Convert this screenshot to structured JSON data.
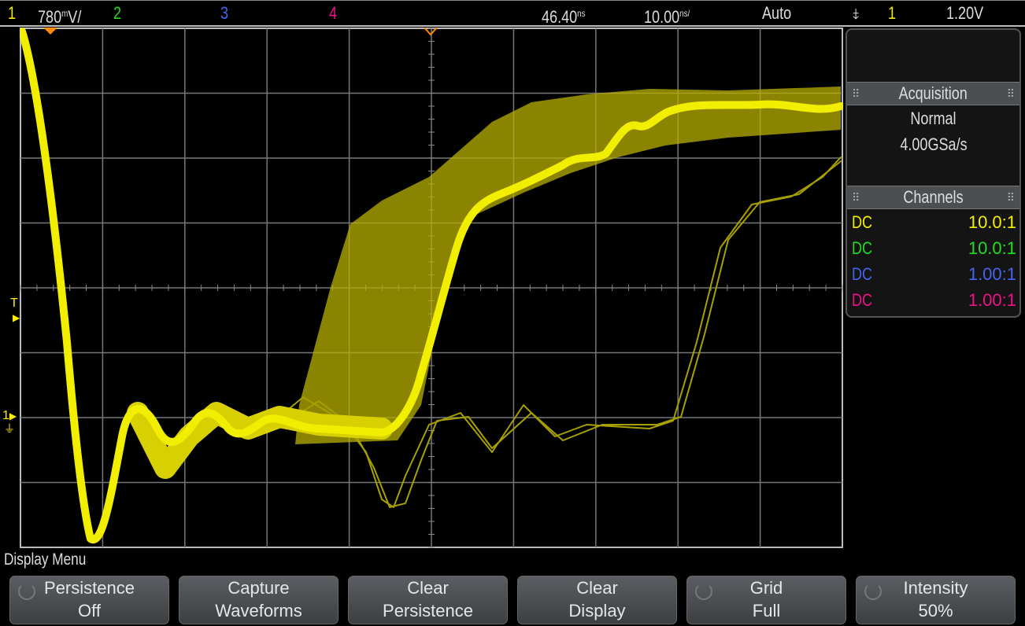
{
  "topbar": {
    "ch1_label": "1",
    "ch1_scale": "780",
    "ch1_scale_prefix": "m",
    "ch1_scale_unit": "V/",
    "ch2_label": "2",
    "ch3_label": "3",
    "ch4_label": "4",
    "time_delay": "46.40",
    "time_delay_unit": "ns",
    "time_scale": "10.00",
    "time_scale_unit": "ns/",
    "trigger_mode": "Auto",
    "trigger_slope_icon": "falling-edge-icon",
    "trigger_source": "1",
    "trigger_level": "1.20V"
  },
  "colors": {
    "ch1": "#f2ee00",
    "ch2": "#22dd22",
    "ch3": "#4466ee",
    "ch4": "#ee1188",
    "marker": "#ff8c00"
  },
  "side_panel": {
    "acquisition": {
      "title": "Acquisition",
      "mode": "Normal",
      "sample_rate": "4.00GSa/s"
    },
    "channels": {
      "title": "Channels",
      "rows": [
        {
          "coupling": "DC",
          "probe": "10.0:1"
        },
        {
          "coupling": "DC",
          "probe": "10.0:1"
        },
        {
          "coupling": "DC",
          "probe": "1.00:1"
        },
        {
          "coupling": "DC",
          "probe": "1.00:1"
        }
      ]
    }
  },
  "markers": {
    "trigger_level": "T",
    "ch1_ground": "1"
  },
  "menu": {
    "title": "Display Menu",
    "softkeys": [
      {
        "line1": "Persistence",
        "line2": "Off",
        "knob": true
      },
      {
        "line1": "Capture",
        "line2": "Waveforms",
        "knob": false
      },
      {
        "line1": "Clear",
        "line2": "Persistence",
        "knob": false
      },
      {
        "line1": "Clear",
        "line2": "Display",
        "knob": false
      },
      {
        "line1": "Grid",
        "line2": "Full",
        "knob": true
      },
      {
        "line1": "Intensity",
        "line2": "50%",
        "knob": true
      }
    ]
  }
}
